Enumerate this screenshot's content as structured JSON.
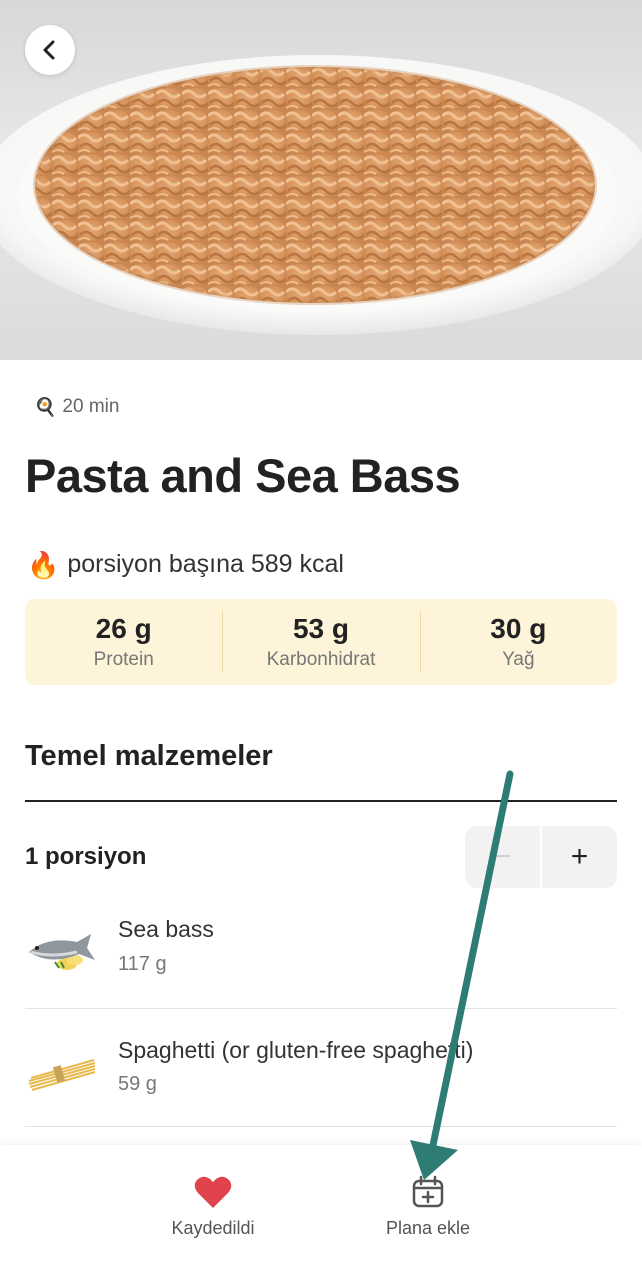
{
  "recipe": {
    "time": "20 min",
    "title": "Pasta and Sea Bass",
    "kcal_text": "porsiyon başına 589 kcal"
  },
  "macros": [
    {
      "value": "26 g",
      "label": "Protein"
    },
    {
      "value": "53 g",
      "label": "Karbonhidrat"
    },
    {
      "value": "30 g",
      "label": "Yağ"
    }
  ],
  "ingredients_section": {
    "title": "Temel malzemeler",
    "portion_label": "1 porsiyon",
    "minus_label": "−",
    "plus_label": "+",
    "items": [
      {
        "name": "Sea bass",
        "amount": "117 g",
        "icon": "sea-bass-image"
      },
      {
        "name": "Spaghetti (or gluten-free spaghetti)",
        "amount": "59 g",
        "icon": "spaghetti-image"
      }
    ]
  },
  "bottom_nav": {
    "saved_label": "Kaydedildi",
    "plan_label": "Plana ekle"
  },
  "icons": {
    "back": "chevron-left-icon",
    "time": "frying-pan-icon",
    "calories": "fire-icon",
    "saved": "heart-icon",
    "plan": "calendar-plus-icon"
  },
  "colors": {
    "macro_bg": "#fdf4d9",
    "heart": "#e0434c",
    "annotation_arrow": "#2e7d74"
  }
}
